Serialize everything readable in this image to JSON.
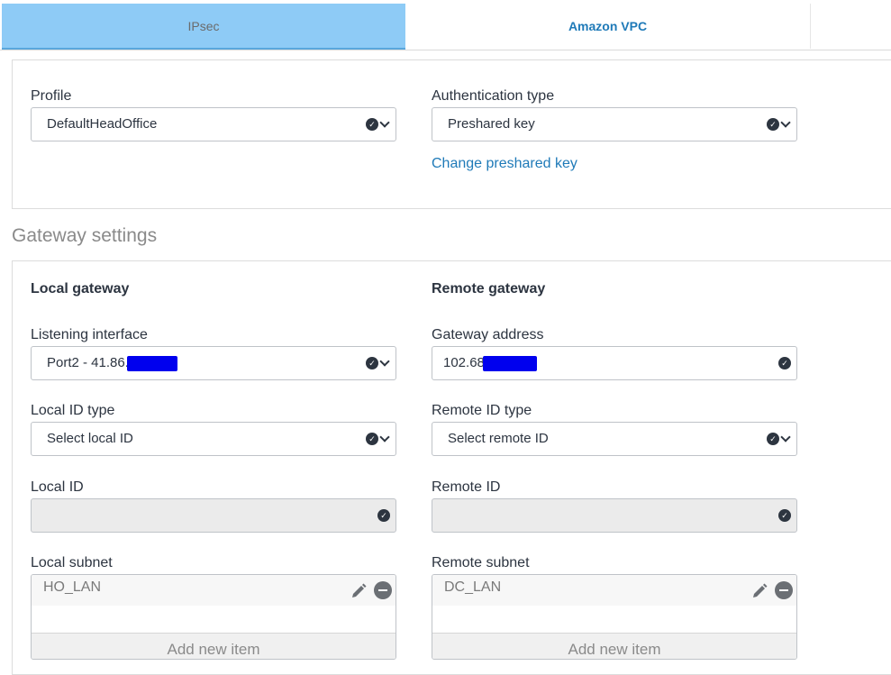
{
  "tabs": [
    {
      "label": "IPsec"
    },
    {
      "label": "Amazon VPC"
    }
  ],
  "profile": {
    "label": "Profile",
    "value": "DefaultHeadOffice"
  },
  "auth": {
    "label": "Authentication type",
    "value": "Preshared key",
    "change_link": "Change preshared key"
  },
  "gateway_settings": {
    "title": "Gateway settings",
    "local": {
      "heading": "Local gateway",
      "listening_label": "Listening interface",
      "listening_value": "Port2 - 41.86.",
      "id_type_label": "Local ID type",
      "id_type_value": "Select local ID",
      "id_label": "Local ID",
      "subnet_label": "Local subnet",
      "subnet_item": "HO_LAN",
      "add_new": "Add new item"
    },
    "remote": {
      "heading": "Remote gateway",
      "address_label": "Gateway address",
      "address_value": "102.68",
      "id_type_label": "Remote ID type",
      "id_type_value": "Select remote ID",
      "id_label": "Remote ID",
      "subnet_label": "Remote subnet",
      "subnet_item": "DC_LAN",
      "add_new": "Add new item"
    }
  },
  "colors": {
    "active_tab": "#8ecbf6",
    "link": "#1f7ab8",
    "redaction": "#0000ee"
  }
}
